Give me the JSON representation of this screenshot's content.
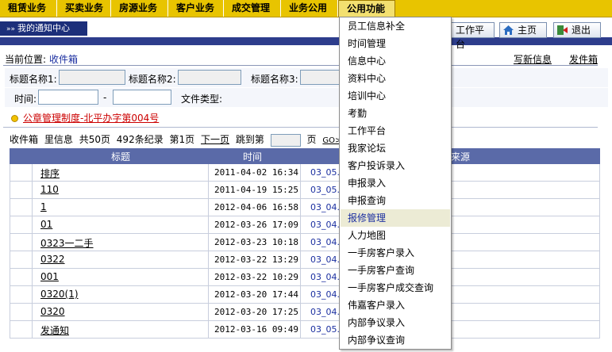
{
  "topnav": {
    "items": [
      {
        "label": "租赁业务"
      },
      {
        "label": "买卖业务"
      },
      {
        "label": "房源业务"
      },
      {
        "label": "客户业务"
      },
      {
        "label": "成交管理"
      },
      {
        "label": "业务公用"
      },
      {
        "label": "公用功能"
      }
    ],
    "active_index": 6
  },
  "header": {
    "title": "我的通知中心",
    "buttons": {
      "workbench": "工作平台",
      "home": "主页",
      "logout": "退出"
    }
  },
  "location": {
    "label": "当前位置:",
    "value": "收件箱",
    "links": {
      "compose": "写新信息",
      "outbox": "发件箱"
    }
  },
  "filters": {
    "title1": "标题名称1:",
    "title2": "标题名称2:",
    "title3": "标题名称3:",
    "time": "时间:",
    "dash": "-",
    "filetype": "文件类型:"
  },
  "notice": {
    "text": "公章管理制度-北平办字第004号"
  },
  "pager": {
    "inbox": "收件箱",
    "inbox_info": "里信息",
    "total_pages": "共50页",
    "records": "492条纪录",
    "current": "第1页",
    "next": "下一页",
    "jump": "跳到第",
    "page_unit": "页",
    "go": "GO>>"
  },
  "table": {
    "headers": {
      "title": "标题",
      "time": "时间",
      "source": "来源"
    },
    "rows": [
      {
        "title": "排序",
        "time": "2011-04-02 16:34",
        "source": "03_05."
      },
      {
        "title": "110",
        "time": "2011-04-19 15:25",
        "source": "03_05."
      },
      {
        "title": "1",
        "time": "2012-04-06 16:58",
        "source": "03_04."
      },
      {
        "title": "01",
        "time": "2012-03-26 17:09",
        "source": "03_04."
      },
      {
        "title": "0323一二手",
        "time": "2012-03-23 10:18",
        "source": "03_04."
      },
      {
        "title": "0322",
        "time": "2012-03-22 13:29",
        "source": "03_04."
      },
      {
        "title": "001",
        "time": "2012-03-22 10:29",
        "source": "03_04."
      },
      {
        "title": "0320(1)",
        "time": "2012-03-20 17:44",
        "source": "03_04."
      },
      {
        "title": "0320",
        "time": "2012-03-20 17:25",
        "source": "03_04."
      },
      {
        "title": "发通知",
        "time": "2012-03-16 09:49",
        "source": "03_05."
      }
    ]
  },
  "dropdown": {
    "items": [
      "员工信息补全",
      "时间管理",
      "信息中心",
      "资料中心",
      "培训中心",
      "考勤",
      "工作平台",
      "我家论坛",
      "客户投诉录入",
      "申报录入",
      "申报查询",
      "报修管理",
      "人力地图",
      "一手房客户录入",
      "一手房客户查询",
      "一手房客户成交查询",
      "伟嘉客户录入",
      "内部争议录入",
      "内部争议查询"
    ],
    "highlighted_index": 11
  }
}
